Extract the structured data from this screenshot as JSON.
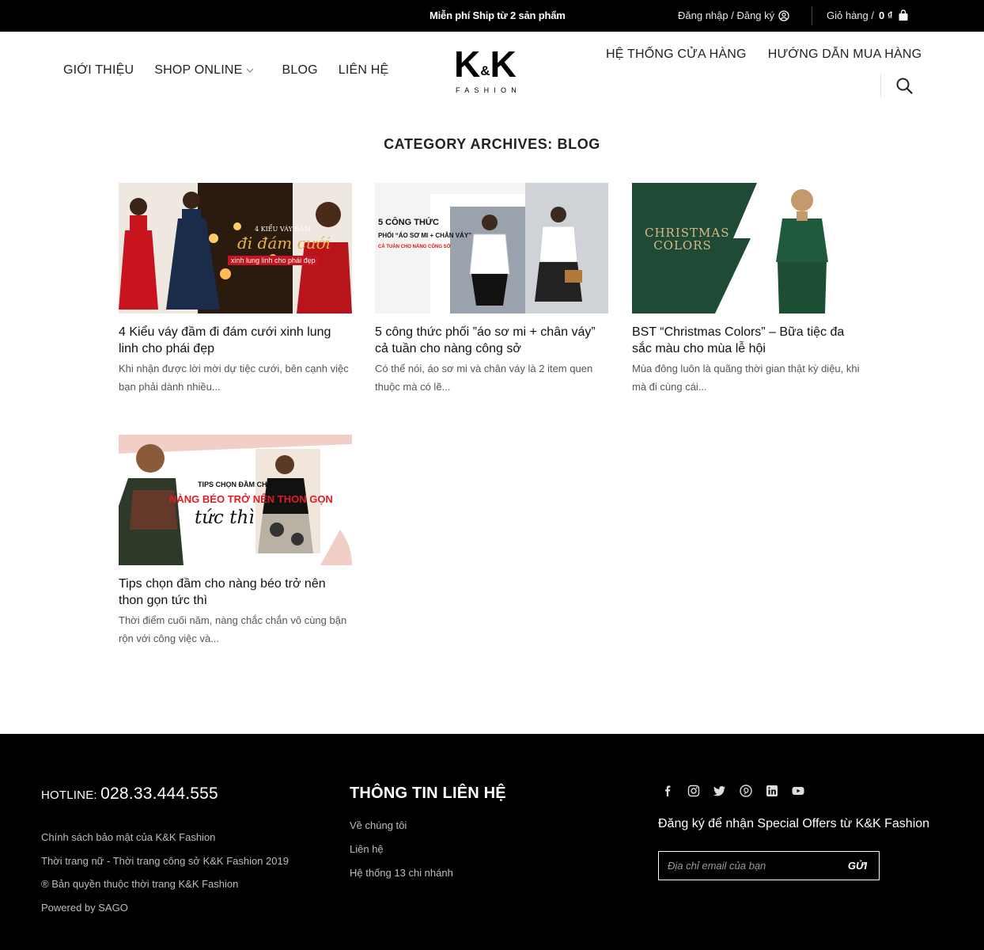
{
  "topbar": {
    "promo": "Miễn phí Ship từ 2 sản phẩm",
    "account": "Đăng nhập / Đăng ký",
    "cart_label": "Giỏ hàng /",
    "cart_total": "0 ₫"
  },
  "nav": {
    "left": [
      "GIỚI THIỆU",
      "SHOP ONLINE",
      "BLOG",
      "LIÊN HỆ"
    ],
    "right": [
      "HỆ THỐNG CỬA HÀNG",
      "HƯỚNG DẪN MUA HÀNG"
    ]
  },
  "logo": {
    "main_left": "K",
    "amp": "&",
    "main_right": "K",
    "sub": "FASHION"
  },
  "page_title": "CATEGORY ARCHIVES: BLOG",
  "posts": [
    {
      "title": "4 Kiểu váy đầm đi đám cưới xinh lung linh cho phái đẹp",
      "excerpt": "Khi nhận được lời mời dự tiệc cưới, bên cạnh việc bạn phải dành nhiều...",
      "thumb_lines": [
        "4 KIỂU VÁY ĐẦM",
        "đi đám cưới",
        "xinh lung linh cho phái đẹp"
      ]
    },
    {
      "title": "5 công thức phối ”áo sơ mi + chân váy” cả tuần cho nàng công sở",
      "excerpt": "Có thể nói, áo sơ mi và chân váy là 2 item quen thuộc mà có lẽ...",
      "thumb_lines": [
        "5 CÔNG THỨC",
        "PHỐI “ÁO SƠ MI + CHÂN VÁY”",
        "CẢ TUẦN CHO NÀNG CÔNG SỞ"
      ]
    },
    {
      "title": "BST “Christmas Colors” – Bữa tiệc đa sắc màu cho mùa lễ hội",
      "excerpt": "Mùa đông luôn là quãng thời gian thật kỳ diệu, khi mà đi cùng cái...",
      "thumb_lines": [
        "CHRISTMAS",
        "COLORS"
      ]
    },
    {
      "title": "Tips chọn đầm cho nàng béo trở nên thon gọn tức thì",
      "excerpt": "Thời điểm cuối năm, nàng chắc chắn vô cùng bận rộn với công việc và...",
      "thumb_lines": [
        "TIPS CHỌN ĐẦM CHO",
        "NÀNG BÉO TRỞ NÊN THON GỌN",
        "tức thì"
      ]
    }
  ],
  "footer": {
    "hotline_label": "HOTLINE:",
    "hotline_number": "028.33.444.555",
    "links": [
      "Chính sách bảo mật của K&K Fashion",
      "Thời trang nữ - Thời trang công sở K&K Fashion 2019",
      "® Bản quyền thuộc thời trang K&K Fashion",
      "Powered by SAGO"
    ],
    "contact_title": "THÔNG TIN LIÊN HỆ",
    "contact_links": [
      "Về chúng tôi",
      "Liên hệ",
      "Hệ thống 13 chi nhánh"
    ],
    "socials": [
      "facebook-icon",
      "instagram-icon",
      "twitter-icon",
      "pinterest-icon",
      "linkedin-icon",
      "youtube-icon"
    ],
    "subscribe_title": "Đăng ký để nhận Special Offers từ K&K Fashion",
    "subscribe_placeholder": "Địa chỉ email của bạn",
    "subscribe_button": "GỬI"
  },
  "colors": {
    "topbar_bg": "#000000",
    "footer_bg": "#000000",
    "christmas_green": "#1f4a35",
    "accent_red": "#e11b22"
  }
}
